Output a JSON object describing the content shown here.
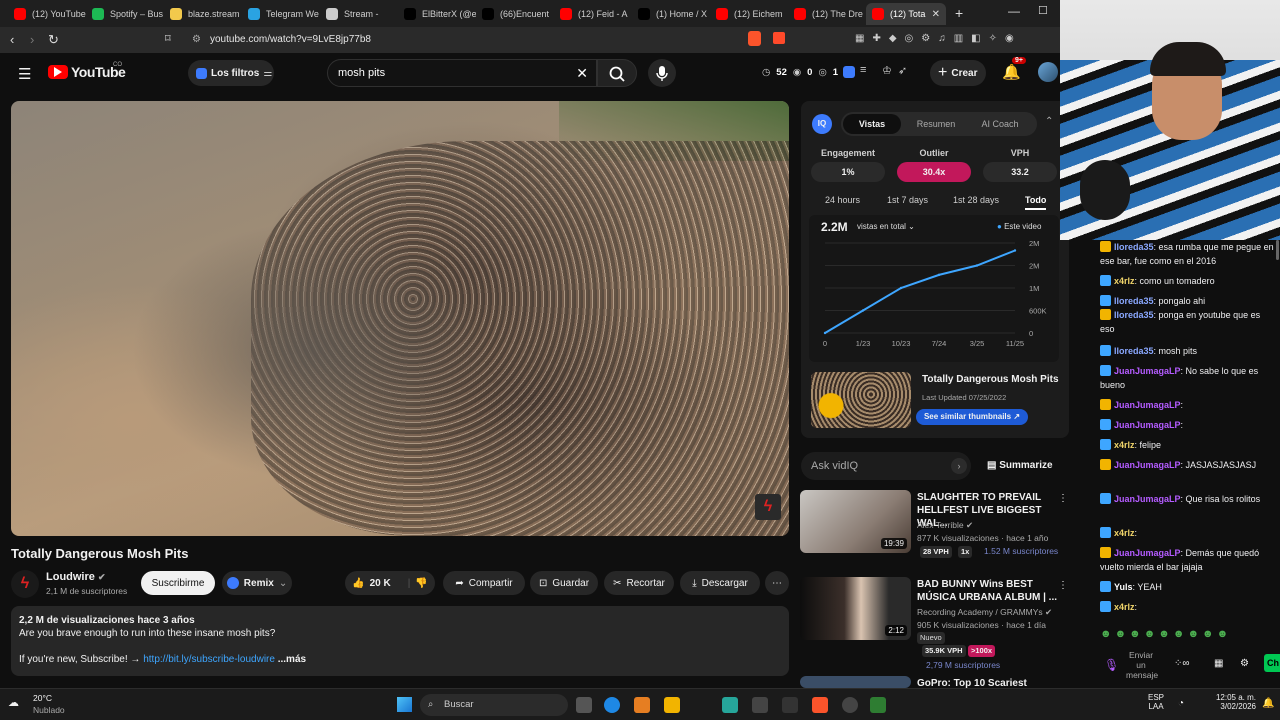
{
  "browser": {
    "tabs": [
      {
        "label": "(12) YouTube",
        "color": "#ff0000"
      },
      {
        "label": "Spotify – Bus",
        "color": "#1db954"
      },
      {
        "label": "blaze.stream",
        "color": "#f2c94c"
      },
      {
        "label": "Telegram We",
        "color": "#2aa3e2"
      },
      {
        "label": "Stream -",
        "color": "#cccccc"
      },
      {
        "label": "ElBitterX (@e",
        "color": "#000000"
      },
      {
        "label": "(66)Encuent",
        "color": "#000000"
      },
      {
        "label": "(12) Feid - A",
        "color": "#ff0000"
      },
      {
        "label": "(1) Home / X",
        "color": "#000000"
      },
      {
        "label": "(12) Eichem",
        "color": "#ff0000"
      },
      {
        "label": "(12) The Dre",
        "color": "#ff0000"
      },
      {
        "label": "(12) Tota",
        "color": "#ff0000"
      }
    ],
    "new_tab": "+",
    "url": "youtube.com/watch?v=9LvE8jp77b8"
  },
  "youtube": {
    "logo": "YouTube",
    "logo_sup": "CO",
    "filters_label": "Los filtros",
    "search_value": "mosh pits",
    "stats": {
      "views": "52",
      "eye": "0",
      "count": "1"
    },
    "create_label": "Crear",
    "notif_badge": "9+"
  },
  "video": {
    "title": "Totally Dangerous Mosh Pits",
    "channel": "Loudwire",
    "subs": "2,1 M de suscriptores",
    "subscribe": "Suscribirme",
    "remix": "Remix",
    "likes": "20 K",
    "share": "Compartir",
    "save": "Guardar",
    "clip": "Recortar",
    "download": "Descargar",
    "desc_meta": "2,2 M de visualizaciones  hace 3 años",
    "desc_line1": "Are you brave enough to run into these insane mosh pits?",
    "desc_line2": "If you're new, Subscribe! →",
    "desc_link": "http://bit.ly/subscribe-loudwire",
    "desc_more": "...más"
  },
  "vidiq": {
    "logo": "IQ",
    "tabs": [
      "Vistas",
      "Resumen",
      "AI Coach"
    ],
    "metrics": [
      {
        "label": "Engagement",
        "value": "1%"
      },
      {
        "label": "Outlier",
        "value": "30.4x"
      },
      {
        "label": "VPH",
        "value": "33.2"
      }
    ],
    "periods": [
      "24 hours",
      "1st 7 days",
      "1st 28 days",
      "Todo"
    ],
    "total": "2.2M",
    "total_select": "vistas en total",
    "legend": "Este video",
    "similar_title": "Totally Dangerous Mosh Pits",
    "similar_updated": "Last Updated 07/25/2022",
    "similar_btn": "See similar thumbnails ↗",
    "ask_placeholder": "Ask vidIQ",
    "summarize": "Summarize",
    "accent": "#c2185b"
  },
  "chart_data": {
    "type": "line",
    "x": [
      "0",
      "1/23",
      "10/23",
      "7/24",
      "3/25",
      "11/25"
    ],
    "series": [
      {
        "values": [
          0.0,
          0.6,
          1.2,
          1.55,
          1.8,
          2.2
        ]
      }
    ],
    "yticks": [
      "0",
      "600K",
      "1M",
      "2M",
      "2M"
    ],
    "ylim": [
      0,
      2.4
    ]
  },
  "recommendations": [
    {
      "title": "SLAUGHTER TO PREVAIL HELLFEST LIVE BIGGEST WAL...",
      "channel": "Alex Terrible",
      "meta": "877 K visualizaciones · hace 1 año",
      "duration": "19:39",
      "tags": [
        "28 VPH",
        "1x"
      ],
      "subs": "1.52 M suscriptores",
      "subs_color": "#5c6bc0"
    },
    {
      "title": "BAD BUNNY Wins BEST MÚSICA URBANA ALBUM | ...",
      "channel": "Recording Academy / GRAMMYs",
      "meta": "905 K visualizaciones · hace 1 día",
      "duration": "2:12",
      "extra": "Nuevo",
      "tags": [
        "35.9K VPH",
        ">100x"
      ],
      "subs": "2,79 M suscriptores",
      "subs_color": "#5c6bc0"
    },
    {
      "title": "GoPro: Top 10 Scariest",
      "channel": "",
      "meta": "",
      "duration": "",
      "tags": [],
      "subs": ""
    }
  ],
  "chat": {
    "lines": [
      {
        "user": "lloreda35",
        "text": "esa rumba que me pegue en ese bar, fue como en el 2016",
        "color": "#8aa8ff"
      },
      {
        "user": "x4rlz",
        "text": "como un tomadero",
        "color": "#f1d56a"
      },
      {
        "user": "lloreda35",
        "text": "pongalo ahi",
        "color": "#8aa8ff"
      },
      {
        "user": "lloreda35",
        "text": "ponga en youtube que es eso",
        "color": "#8aa8ff"
      },
      {
        "user": "lloreda35",
        "text": "mosh pits",
        "color": "#8aa8ff"
      },
      {
        "user": "JuanJumagaLP",
        "text": "No sabe lo que es bueno",
        "color": "#b45cff"
      },
      {
        "user": "JuanJumagaLP",
        "text": "",
        "color": "#b45cff"
      },
      {
        "user": "JuanJumagaLP",
        "text": "",
        "color": "#b45cff"
      },
      {
        "user": "x4rlz",
        "text": "felipe",
        "color": "#f1d56a"
      },
      {
        "user": "JuanJumagaLP",
        "text": "JASJASJASJASJ",
        "color": "#b45cff"
      },
      {
        "user": "JuanJumagaLP",
        "text": "Que risa los rolitos",
        "color": "#b45cff"
      },
      {
        "user": "x4rlz",
        "text": "",
        "color": "#f1d56a"
      },
      {
        "user": "JuanJumagaLP",
        "text": "Demás que quedó vuelto mierda el bar jajaja",
        "color": "#b45cff"
      },
      {
        "user": "Yuls",
        "text": "YEAH",
        "color": "#ffffff"
      },
      {
        "user": "x4rlz",
        "text": "",
        "color": "#f1d56a"
      }
    ],
    "input_placeholder": "Enviar un mensaje",
    "send": "Ch"
  },
  "taskbar": {
    "weather_temp": "20°C",
    "weather_desc": "Nublado",
    "search": "Buscar",
    "lang1": "ESP",
    "lang2": "LAA",
    "time": "12:05 a. m.",
    "date": "3/02/2026"
  }
}
